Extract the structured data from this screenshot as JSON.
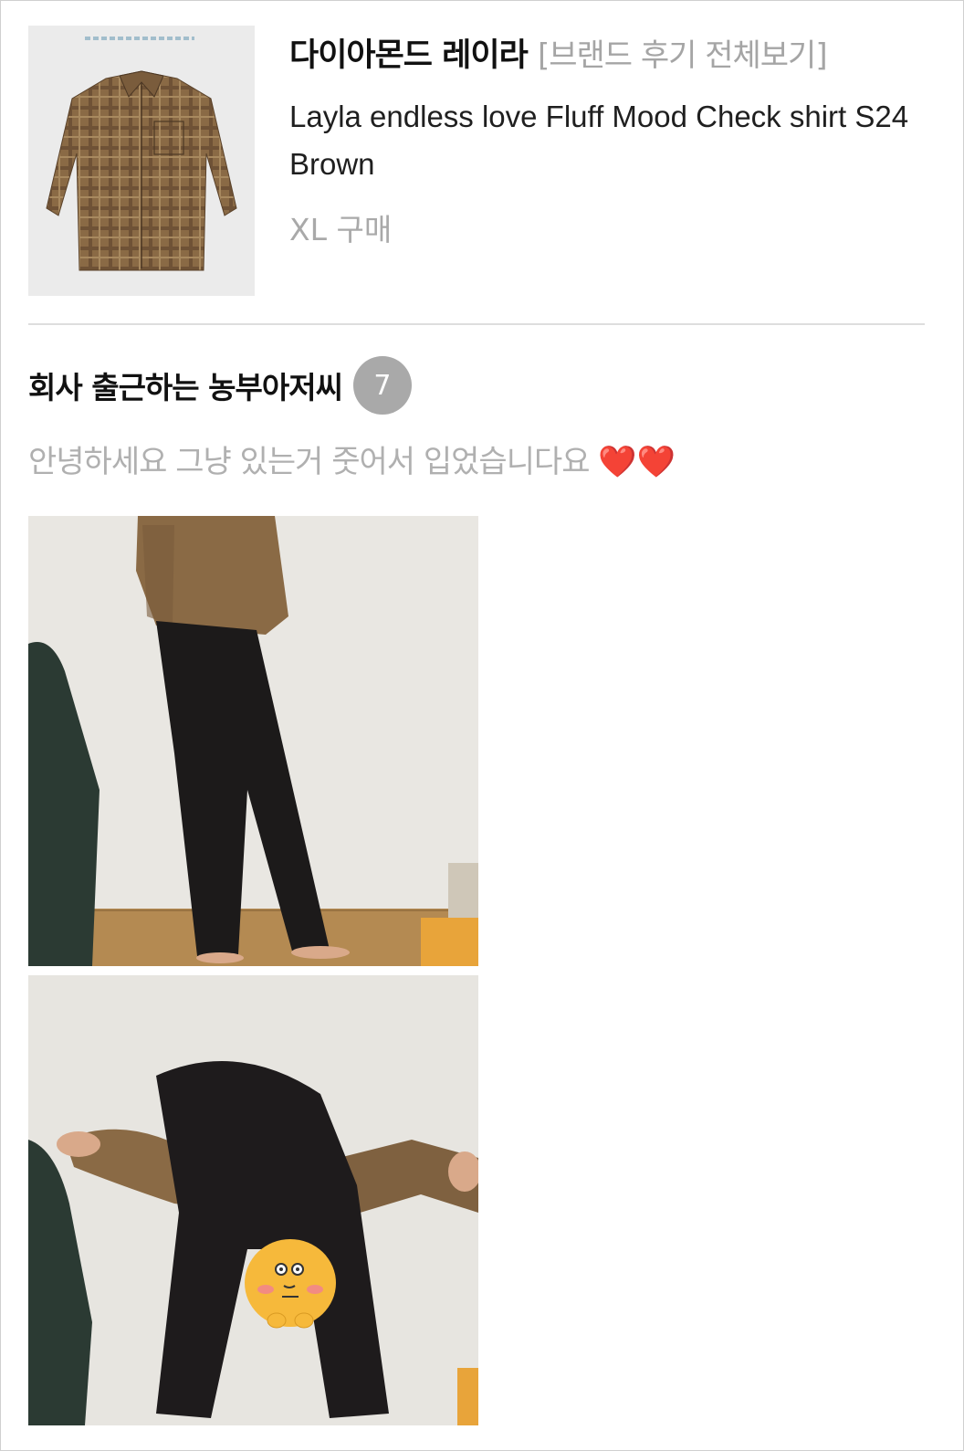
{
  "product": {
    "brand_name": "다이아몬드 레이라",
    "brand_review_link": "[브랜드 후기 전체보기]",
    "name": "Layla endless love Fluff Mood Check shirt S24 Brown",
    "option": "XL 구매"
  },
  "review": {
    "reviewer_name": "회사 출근하는 농부아저씨",
    "level": "7",
    "text": "안녕하세요 그냥 있는거 줏어서 입었습니다요",
    "hearts": "❤️❤️"
  },
  "icons": {
    "product_thumbnail": "checked-shirt-image",
    "photo_1": "standing-outfit-photo",
    "photo_2": "bending-outfit-photo",
    "sticker": "yellow-character-sticker"
  },
  "colors": {
    "link_gray": "#a5a5a5",
    "badge_gray": "#a9a9a9",
    "heart_red": "#e53935",
    "shirt_brown": "#8a6a45",
    "sticker_yellow": "#f6b93b"
  }
}
